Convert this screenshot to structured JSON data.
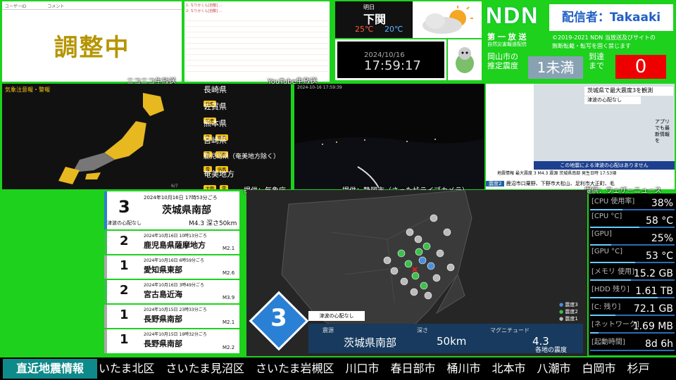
{
  "chat": {
    "col1": "ユーザーID",
    "col2": "コメント",
    "status": "調整中",
    "footer": "ニコニコ生放送"
  },
  "youtube": {
    "footer": "YouTube生放送",
    "lines": [
      "1: なりかくん[自動]  ...",
      "2: なりかくん[自動]  ..."
    ]
  },
  "weather": {
    "label": "明日",
    "city": "下関",
    "high": "25℃",
    "low": "20℃"
  },
  "clock": {
    "date": "2024/10/16",
    "time": "17:59:17"
  },
  "ndn": {
    "logo": "NDN",
    "broadcaster": "配信者：Takaaki",
    "sub1": "第 一 放 送",
    "sub2": "自然災害報道配信",
    "copyright": "©2019-2021 NDN 当放送及びサイトの",
    "copyright2": "無断転載・転写を固く禁じます",
    "pred_label1": "岡山市の",
    "pred_label2": "推定震度",
    "pred_value": "1未満",
    "arrival_label1": "到達",
    "arrival_label2": "まで",
    "arrival_value": "0"
  },
  "warnings": {
    "title": "気象注意報・警報",
    "prefs": [
      {
        "name": "長崎県",
        "badges": [
          "強風"
        ]
      },
      {
        "name": "佐賀県",
        "badges": [
          "強風"
        ]
      },
      {
        "name": "熊本県",
        "badges": [
          "雷",
          "強風"
        ]
      },
      {
        "name": "宮崎県",
        "badges": [
          "雷",
          "強風"
        ]
      },
      {
        "name": "鹿児島県（奄美地方除く）",
        "badges": [
          "雷",
          "強風"
        ]
      },
      {
        "name": "奄美地方",
        "badges": [
          "大雨",
          "雷"
        ]
      }
    ],
    "page": "6/7",
    "credit": "提供：気象庁"
  },
  "camera": {
    "stamp": "2024-10-16 17:59:39",
    "credit": "提供：静岡市（さった峠ライブカメラ）"
  },
  "news": {
    "headline": "茨城県で最大震度3を観測",
    "subhead": "津波の心配なし",
    "side": "アプリでも最新情報を",
    "banner": "この地震による津波の心配はありません",
    "info_title": "地震情報",
    "info_line": "最大震度 3   M4.3  震源 茨城県南部  発生日時 17:53頃",
    "shindo_label": "震度2",
    "shindo_places": "鹿沼市口粟野、下野市大松山、足利市大正町、毛",
    "credit": "提供：ウェザーニュース"
  },
  "eq_latest": {
    "intensity": "3",
    "date": "2024年10月16日 17時53分ごろ",
    "place": "茨城県南部",
    "tsunami": "津波の心配なし",
    "detail": "M4.3 深さ50km"
  },
  "eq_list": [
    {
      "intensity": "2",
      "date": "2024年10月16日 10時13分ごろ",
      "place": "鹿児島県薩摩地方",
      "mag": "M2.1"
    },
    {
      "intensity": "1",
      "date": "2024年10月16日 6時59分ごろ",
      "place": "愛知県東部",
      "mag": "M2.6"
    },
    {
      "intensity": "2",
      "date": "2024年10月16日 3時49分ごろ",
      "place": "宮古島近海",
      "mag": "M3.9"
    },
    {
      "intensity": "1",
      "date": "2024年10月15日 23時33分ごろ",
      "place": "長野県南部",
      "mag": "M2.1"
    },
    {
      "intensity": "1",
      "date": "2024年10月15日 19時32分ごろ",
      "place": "長野県南部",
      "mag": "M2.2"
    }
  ],
  "centermap": {
    "intensity": "3",
    "tsunami": "津波の心配なし",
    "source_label": "震源",
    "source": "茨城県南部",
    "depth_label": "深さ",
    "depth": "50km",
    "mag_label": "マグニチュード",
    "mag": "4.3",
    "legend": [
      "震度3",
      "震度2",
      "震度1"
    ],
    "legend_colors": [
      "#4a90d9",
      "#3cbf4c",
      "#bbbbbb"
    ],
    "footer": "各地の震度"
  },
  "system": [
    {
      "label": "[CPU 使用率]",
      "value": "38%",
      "fill": 0.38
    },
    {
      "label": "[CPU °C]",
      "value": "58 °C",
      "fill": 0.58
    },
    {
      "label": "[GPU]",
      "value": "25%",
      "fill": 0.25
    },
    {
      "label": "[GPU °C]",
      "value": "53 °C",
      "fill": 0.53
    },
    {
      "label": "[メモリ 使用]",
      "value": "15.2 GB",
      "fill": 0.48
    },
    {
      "label": "[HDD 残り]",
      "value": "1.61 TB",
      "fill": 0.8
    },
    {
      "label": "[C: 残り]",
      "value": "72.1 GB",
      "fill": 0.3
    },
    {
      "label": "[ネットワーク]",
      "value": "1.69 MB",
      "fill": 0.1
    },
    {
      "label": "[起動時間]",
      "value": "8d 6h",
      "fill": 0
    }
  ],
  "ticker": {
    "tag": "直近地震情報",
    "text": "いたま北区　さいたま見沼区　さいたま岩槻区　川口市　春日部市　桶川市　北本市　八潮市　白岡市　杉戸"
  }
}
